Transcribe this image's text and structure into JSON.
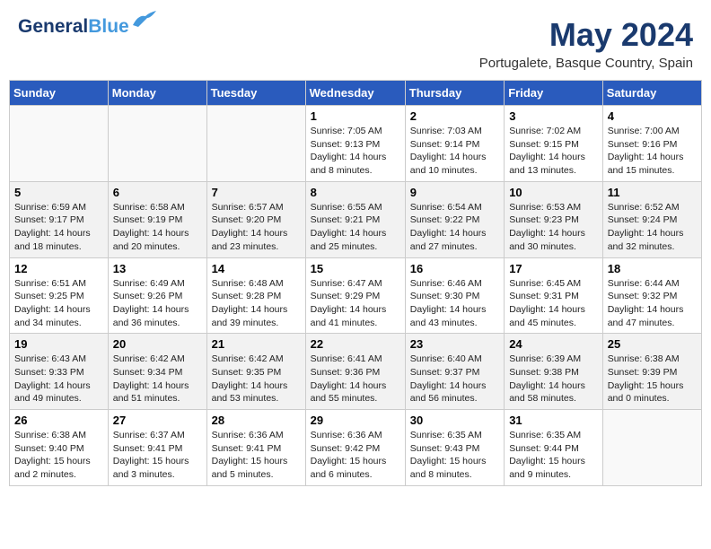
{
  "header": {
    "logo_general": "General",
    "logo_blue": "Blue",
    "month_title": "May 2024",
    "location": "Portugalete, Basque Country, Spain"
  },
  "days_of_week": [
    "Sunday",
    "Monday",
    "Tuesday",
    "Wednesday",
    "Thursday",
    "Friday",
    "Saturday"
  ],
  "rows": [
    [
      {
        "day": "",
        "content": ""
      },
      {
        "day": "",
        "content": ""
      },
      {
        "day": "",
        "content": ""
      },
      {
        "day": "1",
        "content": "Sunrise: 7:05 AM\nSunset: 9:13 PM\nDaylight: 14 hours\nand 8 minutes."
      },
      {
        "day": "2",
        "content": "Sunrise: 7:03 AM\nSunset: 9:14 PM\nDaylight: 14 hours\nand 10 minutes."
      },
      {
        "day": "3",
        "content": "Sunrise: 7:02 AM\nSunset: 9:15 PM\nDaylight: 14 hours\nand 13 minutes."
      },
      {
        "day": "4",
        "content": "Sunrise: 7:00 AM\nSunset: 9:16 PM\nDaylight: 14 hours\nand 15 minutes."
      }
    ],
    [
      {
        "day": "5",
        "content": "Sunrise: 6:59 AM\nSunset: 9:17 PM\nDaylight: 14 hours\nand 18 minutes."
      },
      {
        "day": "6",
        "content": "Sunrise: 6:58 AM\nSunset: 9:19 PM\nDaylight: 14 hours\nand 20 minutes."
      },
      {
        "day": "7",
        "content": "Sunrise: 6:57 AM\nSunset: 9:20 PM\nDaylight: 14 hours\nand 23 minutes."
      },
      {
        "day": "8",
        "content": "Sunrise: 6:55 AM\nSunset: 9:21 PM\nDaylight: 14 hours\nand 25 minutes."
      },
      {
        "day": "9",
        "content": "Sunrise: 6:54 AM\nSunset: 9:22 PM\nDaylight: 14 hours\nand 27 minutes."
      },
      {
        "day": "10",
        "content": "Sunrise: 6:53 AM\nSunset: 9:23 PM\nDaylight: 14 hours\nand 30 minutes."
      },
      {
        "day": "11",
        "content": "Sunrise: 6:52 AM\nSunset: 9:24 PM\nDaylight: 14 hours\nand 32 minutes."
      }
    ],
    [
      {
        "day": "12",
        "content": "Sunrise: 6:51 AM\nSunset: 9:25 PM\nDaylight: 14 hours\nand 34 minutes."
      },
      {
        "day": "13",
        "content": "Sunrise: 6:49 AM\nSunset: 9:26 PM\nDaylight: 14 hours\nand 36 minutes."
      },
      {
        "day": "14",
        "content": "Sunrise: 6:48 AM\nSunset: 9:28 PM\nDaylight: 14 hours\nand 39 minutes."
      },
      {
        "day": "15",
        "content": "Sunrise: 6:47 AM\nSunset: 9:29 PM\nDaylight: 14 hours\nand 41 minutes."
      },
      {
        "day": "16",
        "content": "Sunrise: 6:46 AM\nSunset: 9:30 PM\nDaylight: 14 hours\nand 43 minutes."
      },
      {
        "day": "17",
        "content": "Sunrise: 6:45 AM\nSunset: 9:31 PM\nDaylight: 14 hours\nand 45 minutes."
      },
      {
        "day": "18",
        "content": "Sunrise: 6:44 AM\nSunset: 9:32 PM\nDaylight: 14 hours\nand 47 minutes."
      }
    ],
    [
      {
        "day": "19",
        "content": "Sunrise: 6:43 AM\nSunset: 9:33 PM\nDaylight: 14 hours\nand 49 minutes."
      },
      {
        "day": "20",
        "content": "Sunrise: 6:42 AM\nSunset: 9:34 PM\nDaylight: 14 hours\nand 51 minutes."
      },
      {
        "day": "21",
        "content": "Sunrise: 6:42 AM\nSunset: 9:35 PM\nDaylight: 14 hours\nand 53 minutes."
      },
      {
        "day": "22",
        "content": "Sunrise: 6:41 AM\nSunset: 9:36 PM\nDaylight: 14 hours\nand 55 minutes."
      },
      {
        "day": "23",
        "content": "Sunrise: 6:40 AM\nSunset: 9:37 PM\nDaylight: 14 hours\nand 56 minutes."
      },
      {
        "day": "24",
        "content": "Sunrise: 6:39 AM\nSunset: 9:38 PM\nDaylight: 14 hours\nand 58 minutes."
      },
      {
        "day": "25",
        "content": "Sunrise: 6:38 AM\nSunset: 9:39 PM\nDaylight: 15 hours\nand 0 minutes."
      }
    ],
    [
      {
        "day": "26",
        "content": "Sunrise: 6:38 AM\nSunset: 9:40 PM\nDaylight: 15 hours\nand 2 minutes."
      },
      {
        "day": "27",
        "content": "Sunrise: 6:37 AM\nSunset: 9:41 PM\nDaylight: 15 hours\nand 3 minutes."
      },
      {
        "day": "28",
        "content": "Sunrise: 6:36 AM\nSunset: 9:41 PM\nDaylight: 15 hours\nand 5 minutes."
      },
      {
        "day": "29",
        "content": "Sunrise: 6:36 AM\nSunset: 9:42 PM\nDaylight: 15 hours\nand 6 minutes."
      },
      {
        "day": "30",
        "content": "Sunrise: 6:35 AM\nSunset: 9:43 PM\nDaylight: 15 hours\nand 8 minutes."
      },
      {
        "day": "31",
        "content": "Sunrise: 6:35 AM\nSunset: 9:44 PM\nDaylight: 15 hours\nand 9 minutes."
      },
      {
        "day": "",
        "content": ""
      }
    ]
  ]
}
